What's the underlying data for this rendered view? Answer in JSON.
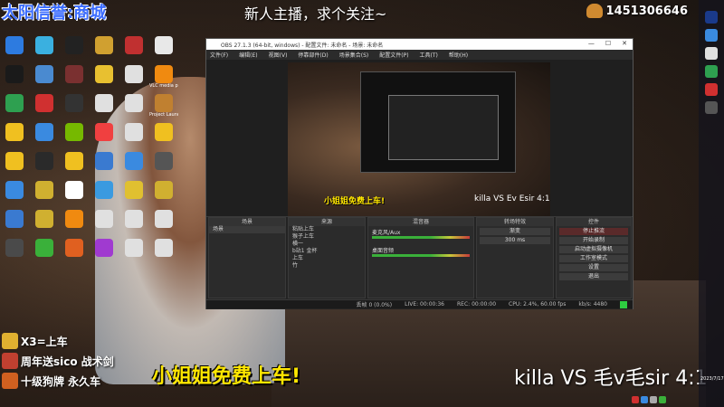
{
  "stream": {
    "top_left_banner": "太阳信誉:商城",
    "top_title": "新人主播，求个关注~",
    "room_id": "1451306646",
    "caption": "小姐姐免费上车!",
    "score": "killa VS 毛v毛sir 4:1",
    "overlay_lines": [
      "X3=上车",
      "周年送sico 战术剑",
      "十级狗牌 永久车"
    ]
  },
  "desktop_icons": [
    {
      "label": "",
      "color": "#2d7be0"
    },
    {
      "label": "",
      "color": "#3ab0e0"
    },
    {
      "label": "",
      "color": "#222"
    },
    {
      "label": "",
      "color": "#d0a030"
    },
    {
      "label": "",
      "color": "#c03030"
    },
    {
      "label": "",
      "color": "#e8e8e8"
    },
    {
      "label": "",
      "color": "#1a1a1a"
    },
    {
      "label": "",
      "color": "#4a8ad0"
    },
    {
      "label": "",
      "color": "#7a3030"
    },
    {
      "label": "",
      "color": "#e8c030"
    },
    {
      "label": "",
      "color": "#e0e0e0"
    },
    {
      "label": "VLC media player",
      "color": "#f08a10"
    },
    {
      "label": "",
      "color": "#2ea050"
    },
    {
      "label": "",
      "color": "#d03030"
    },
    {
      "label": "",
      "color": "#333"
    },
    {
      "label": "",
      "color": "#e0e0e0"
    },
    {
      "label": "",
      "color": "#e0e0e0"
    },
    {
      "label": "Project Launcher",
      "color": "#c08030"
    },
    {
      "label": "",
      "color": "#f0c020"
    },
    {
      "label": "",
      "color": "#3a8ae0"
    },
    {
      "label": "",
      "color": "#76b900"
    },
    {
      "label": "",
      "color": "#f04040"
    },
    {
      "label": "",
      "color": "#e0e0e0"
    },
    {
      "label": "",
      "color": "#f0c020"
    },
    {
      "label": "",
      "color": "#f0c020"
    },
    {
      "label": "",
      "color": "#2a2a2a"
    },
    {
      "label": "",
      "color": "#f0c020"
    },
    {
      "label": "",
      "color": "#3a7ad0"
    },
    {
      "label": "",
      "color": "#3a8ae0"
    },
    {
      "label": "",
      "color": "#555"
    },
    {
      "label": "",
      "color": "#3a8ae0"
    },
    {
      "label": "",
      "color": "#d0b030"
    },
    {
      "label": "",
      "color": "#fff"
    },
    {
      "label": "",
      "color": "#3a9ae0"
    },
    {
      "label": "",
      "color": "#e0c030"
    },
    {
      "label": "",
      "color": "#d0b030"
    },
    {
      "label": "",
      "color": "#3a7ad0"
    },
    {
      "label": "",
      "color": "#d0b030"
    },
    {
      "label": "",
      "color": "#f08a10"
    },
    {
      "label": "",
      "color": "#e0e0e0"
    },
    {
      "label": "",
      "color": "#e0e0e0"
    },
    {
      "label": "",
      "color": "#e0e0e0"
    },
    {
      "label": "",
      "color": "#4a4a4a"
    },
    {
      "label": "",
      "color": "#3ab03a"
    },
    {
      "label": "",
      "color": "#e06020"
    },
    {
      "label": "",
      "color": "#a03ad0"
    },
    {
      "label": "",
      "color": "#e0e0e0"
    },
    {
      "label": "",
      "color": "#e0e0e0"
    }
  ],
  "obs": {
    "title": "OBS 27.1.3 (64-bit, windows) - 配置文件: 未命名 - 场景: 未命名",
    "menu": [
      "文件(F)",
      "编辑(E)",
      "视图(V)",
      "停靠部件(D)",
      "场景集合(S)",
      "配置文件(P)",
      "工具(T)",
      "帮助(H)"
    ],
    "preview_caption": "小姐姐免费上车!",
    "preview_score": "killa VS    Ev Esir 4:1",
    "docks": {
      "scenes_title": "场景",
      "scenes_item": "场景",
      "sources_title": "来源",
      "sources_items": [
        "粘贴上车",
        "猴子上车",
        "横一",
        "b站1 金杯",
        "上车",
        "竹"
      ],
      "mixer_title": "混音器",
      "mixer_rows": [
        "麦克风/Aux",
        "桌面音频"
      ],
      "transitions_title": "转场特效",
      "transition_type": "渐变",
      "transition_duration": "300 ms",
      "controls_title": "控件",
      "controls": [
        "停止推流",
        "开始录制",
        "启动虚拟摄像机",
        "工作室模式",
        "设置",
        "退出"
      ]
    },
    "status": [
      "丢帧 0 (0.0%)",
      "LIVE: 00:00:36",
      "REC: 00:00:00",
      "CPU: 2.4%, 60.00 fps",
      "kb/s: 4480"
    ]
  },
  "tray": {
    "date": "2023/7/17"
  }
}
